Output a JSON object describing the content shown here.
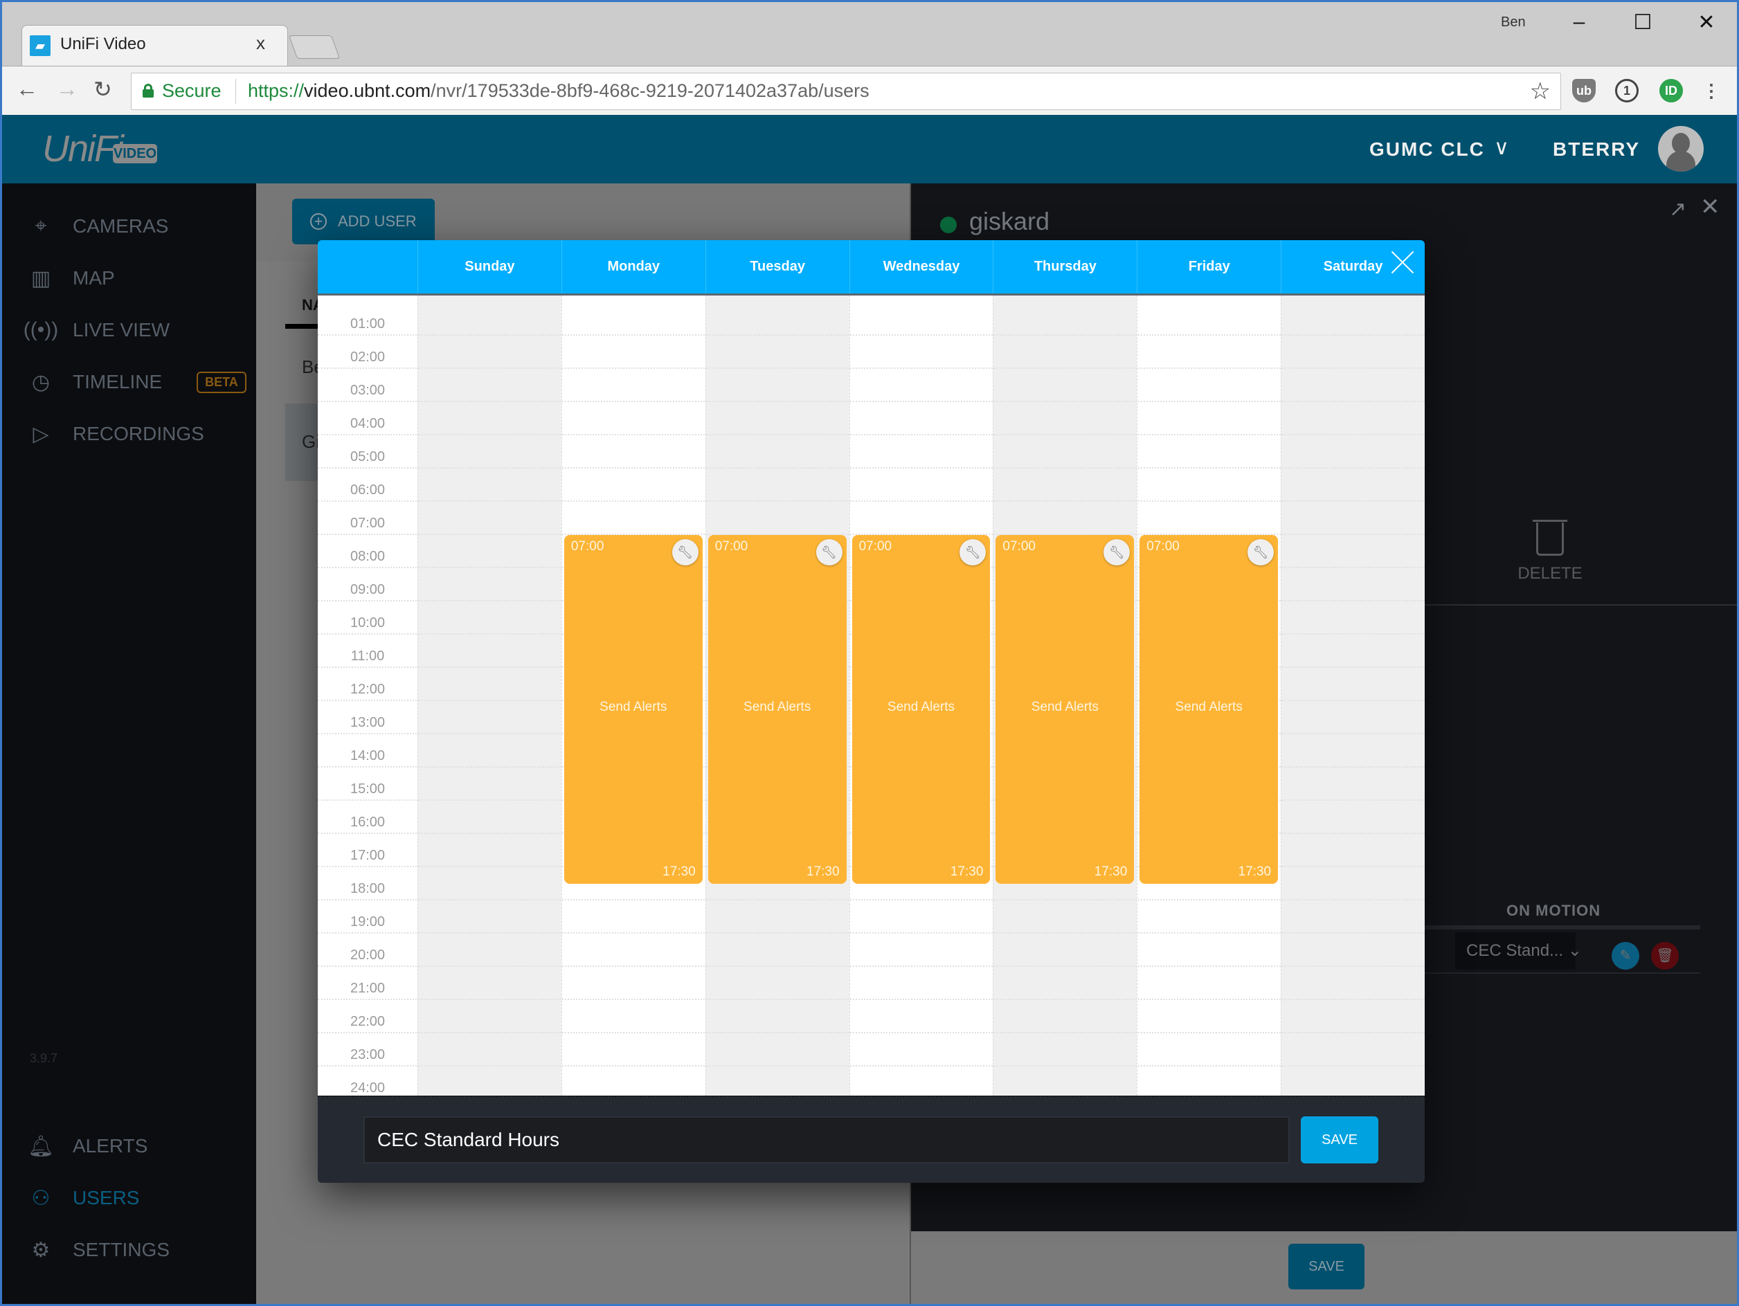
{
  "browser": {
    "tab_title": "UniFi Video",
    "tab_close": "x",
    "profile_name": "Ben",
    "window_controls": {
      "minimize": "–",
      "maximize": "☐",
      "close": "✕"
    },
    "secure_label": "Secure",
    "url_scheme": "https://",
    "url_host": "video.ubnt.com",
    "url_path": "/nvr/179533de-8bf9-468c-9219-2071402a37ab/users",
    "extensions": [
      "ublock-icon",
      "1password-icon",
      "id-extension-icon"
    ]
  },
  "header": {
    "logo_text": "UniFi",
    "logo_badge": "VIDEO",
    "site_name": "GUMC CLC",
    "username": "BTERRY"
  },
  "sidebar": {
    "items": [
      {
        "label": "CAMERAS",
        "icon": "camera-icon"
      },
      {
        "label": "MAP",
        "icon": "map-icon"
      },
      {
        "label": "LIVE VIEW",
        "icon": "live-view-icon"
      },
      {
        "label": "TIMELINE",
        "icon": "clock-icon",
        "badge": "BETA"
      },
      {
        "label": "RECORDINGS",
        "icon": "play-icon"
      }
    ],
    "bottom_items": [
      {
        "label": "ALERTS",
        "icon": "bell-icon"
      },
      {
        "label": "USERS",
        "icon": "users-icon",
        "active": true
      },
      {
        "label": "SETTINGS",
        "icon": "gear-icon"
      }
    ],
    "version": "3.9.7"
  },
  "users_page": {
    "add_user_label": "ADD USER",
    "column_header": "NA",
    "rows": [
      "Be",
      "Gi"
    ]
  },
  "user_panel": {
    "name": "giskard",
    "status": "online",
    "delete_label": "DELETE",
    "on_motion_header": "ON MOTION",
    "schedule_selected": "CEC Stand...",
    "save_label": "SAVE"
  },
  "schedule_modal": {
    "days": [
      "Sunday",
      "Monday",
      "Tuesday",
      "Wednesday",
      "Thursday",
      "Friday",
      "Saturday"
    ],
    "hours": [
      "01:00",
      "02:00",
      "03:00",
      "04:00",
      "05:00",
      "06:00",
      "07:00",
      "08:00",
      "09:00",
      "10:00",
      "11:00",
      "12:00",
      "13:00",
      "14:00",
      "15:00",
      "16:00",
      "17:00",
      "18:00",
      "19:00",
      "20:00",
      "21:00",
      "22:00",
      "23:00",
      "24:00"
    ],
    "blocks": [
      {
        "day": "Monday",
        "start": "07:00",
        "end": "17:30",
        "label": "Send Alerts"
      },
      {
        "day": "Tuesday",
        "start": "07:00",
        "end": "17:30",
        "label": "Send Alerts"
      },
      {
        "day": "Wednesday",
        "start": "07:00",
        "end": "17:30",
        "label": "Send Alerts"
      },
      {
        "day": "Thursday",
        "start": "07:00",
        "end": "17:30",
        "label": "Send Alerts"
      },
      {
        "day": "Friday",
        "start": "07:00",
        "end": "17:30",
        "label": "Send Alerts"
      }
    ],
    "schedule_name": "CEC Standard Hours",
    "save_label": "SAVE"
  },
  "colors": {
    "header_bg": "#00506e",
    "modal_header": "#00aeff",
    "block_fill": "#fdb435",
    "save_button": "#00a3e0",
    "status_online": "#0a6a3c"
  }
}
